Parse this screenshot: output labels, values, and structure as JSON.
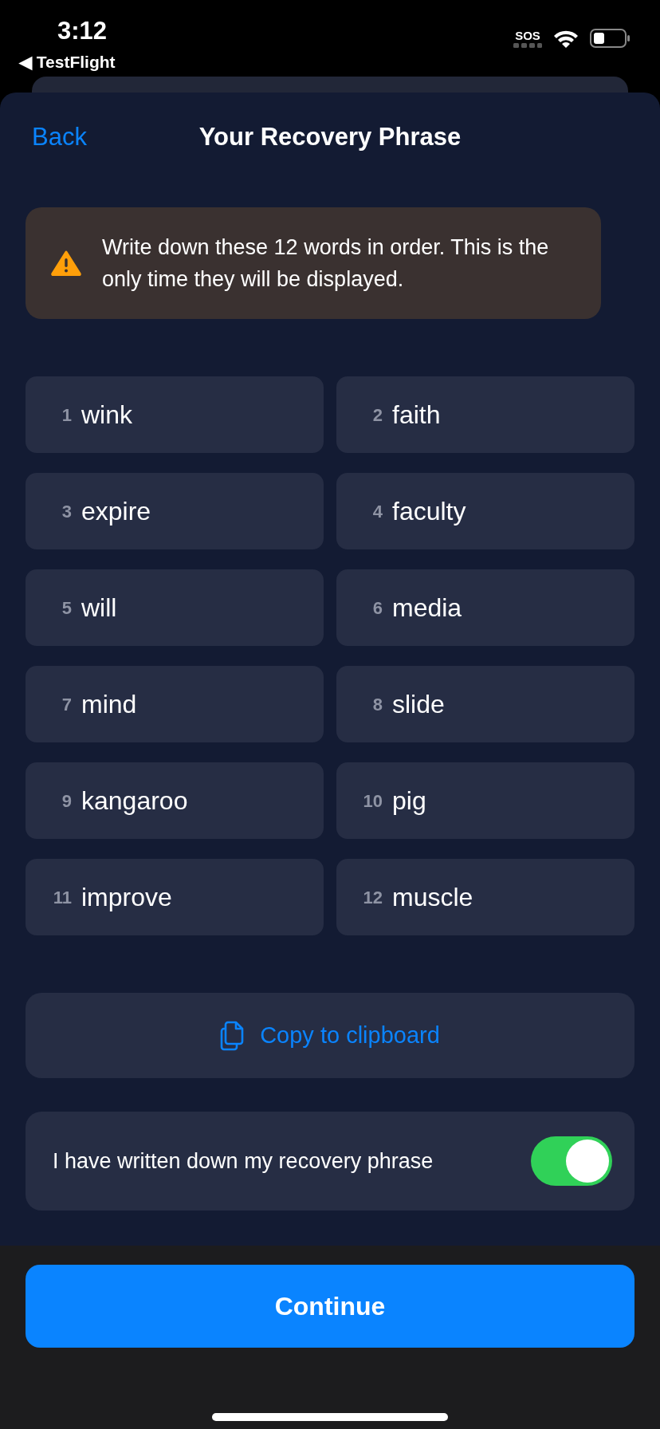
{
  "status_bar": {
    "time": "3:12",
    "back_app": "◀ TestFlight",
    "sos": "SOS"
  },
  "header": {
    "back": "Back",
    "title": "Your Recovery Phrase"
  },
  "warning": {
    "text": "Write down these 12 words in order. This is the only time they will be displayed."
  },
  "words": [
    {
      "number": "1",
      "word": "wink"
    },
    {
      "number": "2",
      "word": "faith"
    },
    {
      "number": "3",
      "word": "expire"
    },
    {
      "number": "4",
      "word": "faculty"
    },
    {
      "number": "5",
      "word": "will"
    },
    {
      "number": "6",
      "word": "media"
    },
    {
      "number": "7",
      "word": "mind"
    },
    {
      "number": "8",
      "word": "slide"
    },
    {
      "number": "9",
      "word": "kangaroo"
    },
    {
      "number": "10",
      "word": "pig"
    },
    {
      "number": "11",
      "word": "improve"
    },
    {
      "number": "12",
      "word": "muscle"
    }
  ],
  "copy_button": "Copy to clipboard",
  "confirm": {
    "label": "I have written down my recovery phrase",
    "on": true
  },
  "continue_button": "Continue"
}
